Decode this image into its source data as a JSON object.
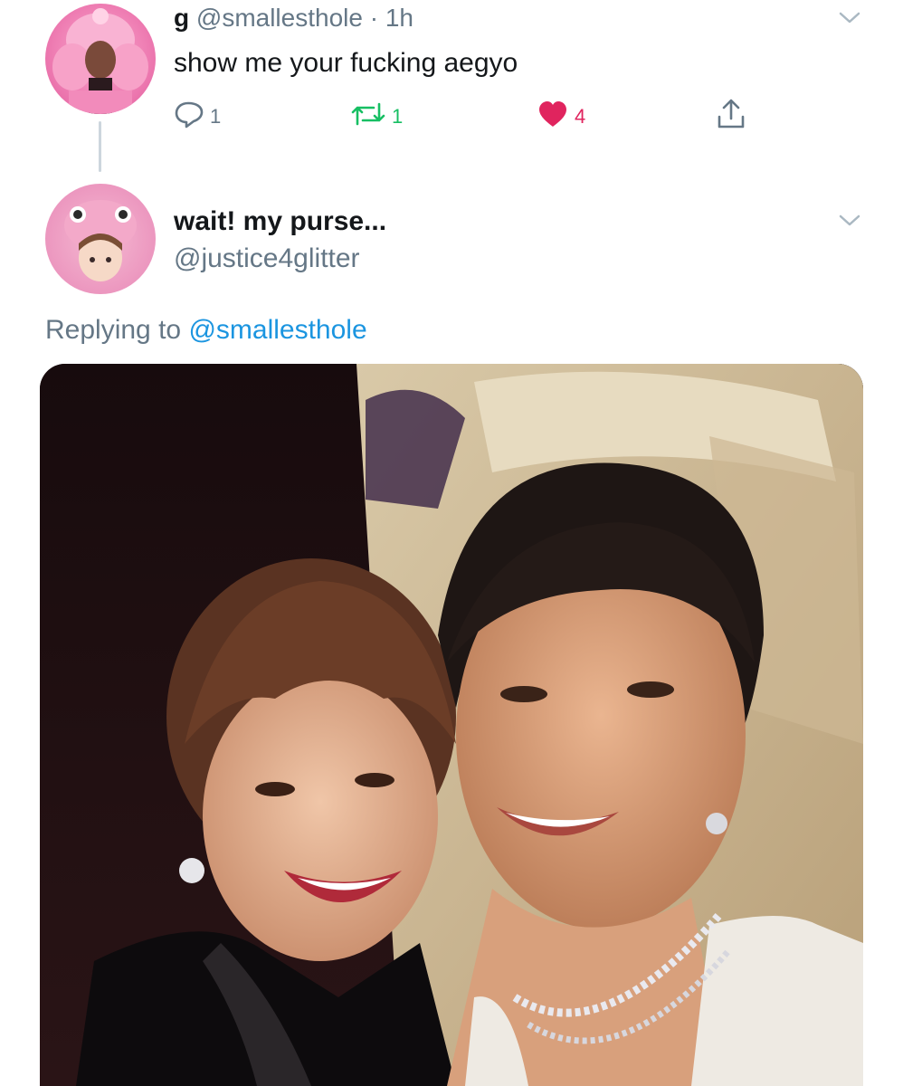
{
  "parent_tweet": {
    "display_name": "g",
    "handle": "@smallesthole",
    "separator": "·",
    "time": "1h",
    "text": "show me your fucking aegyo",
    "reply_count": "1",
    "retweet_count": "1",
    "like_count": "4"
  },
  "reply": {
    "display_name": "wait! my purse...",
    "handle": "@justice4glitter",
    "replying_prefix": "Replying to",
    "replying_handle": "@smallesthole"
  },
  "colors": {
    "text_primary": "#14171a",
    "text_secondary": "#657786",
    "link": "#1b95e0",
    "retweet": "#17bf63",
    "like": "#e0245e"
  },
  "icons": [
    "reply-icon",
    "retweet-icon",
    "heart-icon",
    "share-icon",
    "chevron-down-icon"
  ]
}
